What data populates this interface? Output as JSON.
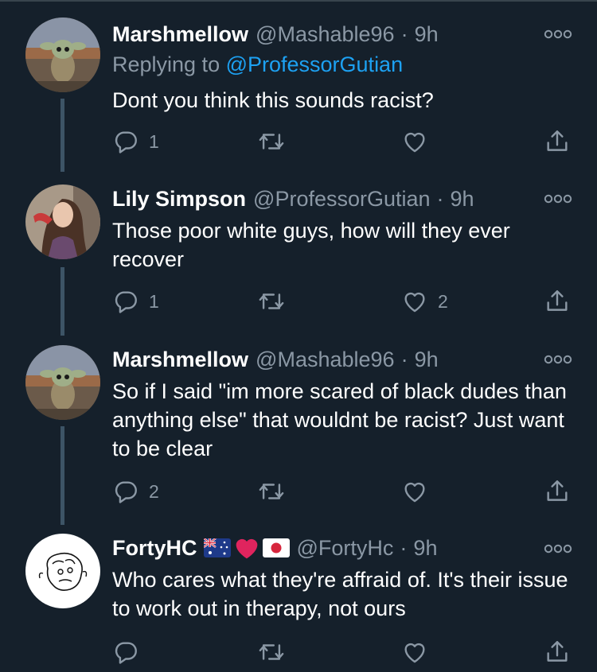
{
  "tweets": [
    {
      "name": "Marshmellow",
      "handle": "@Mashable96",
      "separator": "·",
      "time": "9h",
      "replying_prefix": "Replying to ",
      "replying_to": "@ProfessorGutian",
      "text": "Dont you think this sounds racist?",
      "reply_count": "1",
      "retweet_count": "",
      "like_count": ""
    },
    {
      "name": "Lily Simpson",
      "handle": "@ProfessorGutian",
      "separator": "·",
      "time": "9h",
      "text": "Those poor white guys, how will they ever recover",
      "reply_count": "1",
      "retweet_count": "",
      "like_count": "2"
    },
    {
      "name": "Marshmellow",
      "handle": "@Mashable96",
      "separator": "·",
      "time": "9h",
      "text": "So if I said \"im more scared of black dudes than anything else\" that wouldnt be racist? Just want to be clear",
      "reply_count": "2",
      "retweet_count": "",
      "like_count": ""
    },
    {
      "name": "FortyHC",
      "handle": "@FortyHc",
      "separator": "·",
      "time": "9h",
      "flags": [
        "australia-flag",
        "red-heart",
        "japan-flag"
      ],
      "text": "Who cares what they're affraid of. It's their issue to work out in therapy, not ours",
      "reply_count": "",
      "retweet_count": "",
      "like_count": ""
    }
  ],
  "colors": {
    "background": "#15202b",
    "text": "#ffffff",
    "muted": "#8b98a5",
    "link": "#1da1f2",
    "thread_line": "#3d5466"
  },
  "icons": [
    "reply-icon",
    "retweet-icon",
    "like-icon",
    "share-icon",
    "more-icon"
  ]
}
